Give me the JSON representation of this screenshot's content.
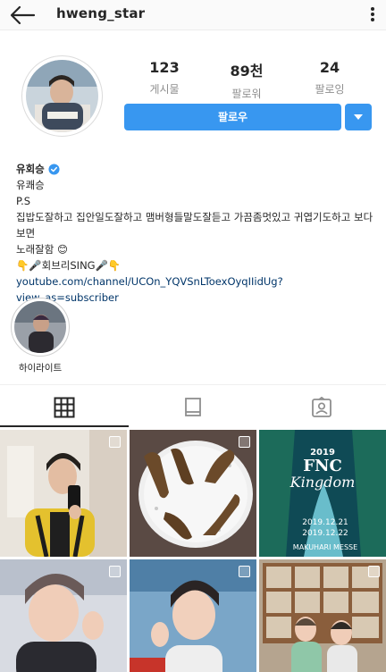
{
  "header": {
    "username": "hweng_star",
    "back_icon": "arrow-left-icon",
    "more_icon": "more-vertical-icon"
  },
  "stats": [
    {
      "value": "123",
      "label": "게시물"
    },
    {
      "value": "89천",
      "label": "팔로워"
    },
    {
      "value": "24",
      "label": "팔로잉"
    }
  ],
  "actions": {
    "follow_label": "팔로우",
    "dropdown_icon": "caret-down-icon",
    "accent_color": "#3897f0"
  },
  "bio": {
    "name": "유회승",
    "category": "유쾌승",
    "line1": "P.S",
    "line2": "집밥도잘하고 집안일도잘하고 맴버형들말도잘듣고 가끔좀멋있고 귀엽기도하고 보다보면",
    "line3": "노래잘함 😊",
    "line4": "👇🎤회브리SING🎤👇",
    "link": "youtube.com/channel/UCOn_YQVSnLToexOyqIIidUg?view_as=subscriber"
  },
  "highlights": [
    {
      "label": "하이라이트"
    }
  ],
  "tabs": [
    {
      "icon": "grid-icon",
      "active": true
    },
    {
      "icon": "igtv-icon",
      "active": false
    },
    {
      "icon": "tagged-icon",
      "active": false
    }
  ],
  "posts": {
    "poster_line1": "2019",
    "poster_line2": "FNC",
    "poster_line3": "Kingdom",
    "poster_date1": "2019.12.21",
    "poster_date2": "2019.12.22",
    "poster_venue": "MAKUHARI MESSE"
  }
}
